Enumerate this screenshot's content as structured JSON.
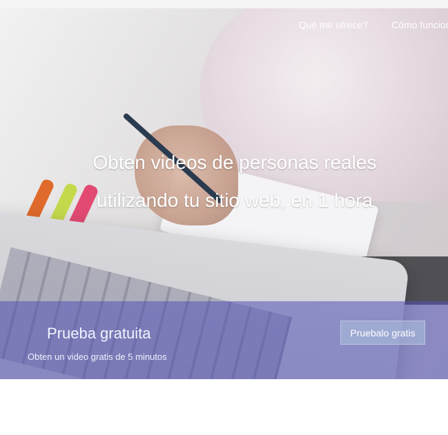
{
  "nav": {
    "links": [
      "Qué me ofrece?",
      "Cómo funciona?"
    ]
  },
  "hero": {
    "headline_line1": "Obten videos de personas reales",
    "headline_line2": "utilizando tu sitio web, en 1 hora"
  },
  "trial": {
    "title": "Prueba gratuita",
    "subtitle": "Obten un video gratis de 5 minutos",
    "button_label": "Pruebalo gratis"
  },
  "colors": {
    "trial_band": "#5254b6",
    "text": "#ffffff"
  }
}
